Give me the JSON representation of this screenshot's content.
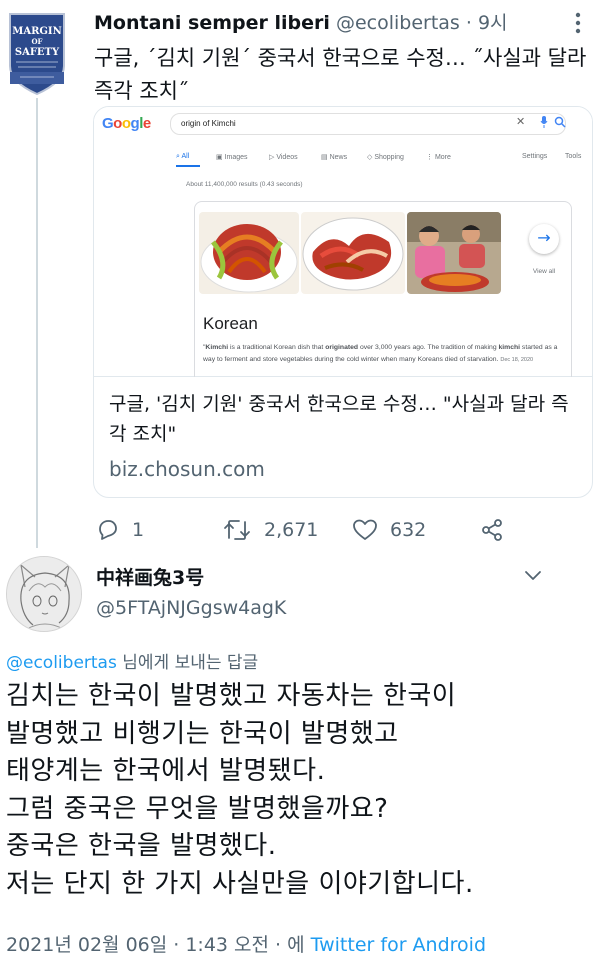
{
  "tweet1": {
    "author_name": "Montani semper liberi",
    "author_handle": "@ecolibertas",
    "time_sep": " · ",
    "time": "9시",
    "avatar_text": [
      "MARGIN",
      "OF",
      "SAFETY"
    ],
    "text": "구글, ˊ김치 기원ˊ 중국서 한국으로 수정… ˝사실과 달라 즉각 조치˝",
    "card": {
      "search_engine": "Google",
      "query": "origin of Kimchi",
      "tabs": [
        "All",
        "Images",
        "Videos",
        "News",
        "Shopping",
        "More",
        "Settings",
        "Tools"
      ],
      "results_count": "About 11,400,000 results (0.43 seconds)",
      "view_all": "View all",
      "panel_title": "Korean",
      "description_parts": [
        "\"",
        "Kimchi",
        " is a traditional Korean dish that ",
        "originated",
        " over 3,000 years ago. The tradition of making ",
        "kimchi",
        " started as a way to ferment and store vegetables during the cold winter when many Koreans died of starvation. "
      ],
      "description_date": "Dec 18, 2020",
      "title": "구글, '김치 기원' 중국서 한국으로 수정… \"사실과 달라 즉각 조치\"",
      "domain": "biz.chosun.com"
    },
    "stats": {
      "replies": "1",
      "retweets": "2,671",
      "likes": "632"
    }
  },
  "tweet2": {
    "author_name": "中祥画兔3号",
    "author_handle": "@5FTAjNJGgsw4agK",
    "reply_mention": "@ecolibertas",
    "reply_suffix": " 님에게 보내는 답글",
    "lines": [
      "김치는 한국이 발명했고 자동차는 한국이",
      "발명했고 비행기는 한국이 발명했고",
      "태양계는 한국에서 발명됐다.",
      "그럼 중국은 무엇을 발명했을까요?",
      "중국은 한국을 발명했다.",
      "저는 단지 한 가지 사실만을 이야기합니다."
    ],
    "timestamp": "2021년 02월 06일 · 1:43 오전 · 에 ",
    "source": "Twitter for Android"
  },
  "colors": {
    "link_blue": "#1d9bf0",
    "secondary_text": "#536471",
    "primary_text": "#0f1419",
    "google_blue": "#4285f4",
    "google_red": "#ea4335",
    "google_yellow": "#fbbc05",
    "google_green": "#34a853"
  },
  "icons": [
    "more-vertical-icon",
    "reply-icon",
    "retweet-icon",
    "like-icon",
    "share-icon",
    "chevron-down-icon",
    "search-icon",
    "mic-icon",
    "close-icon",
    "arrow-right-icon"
  ]
}
